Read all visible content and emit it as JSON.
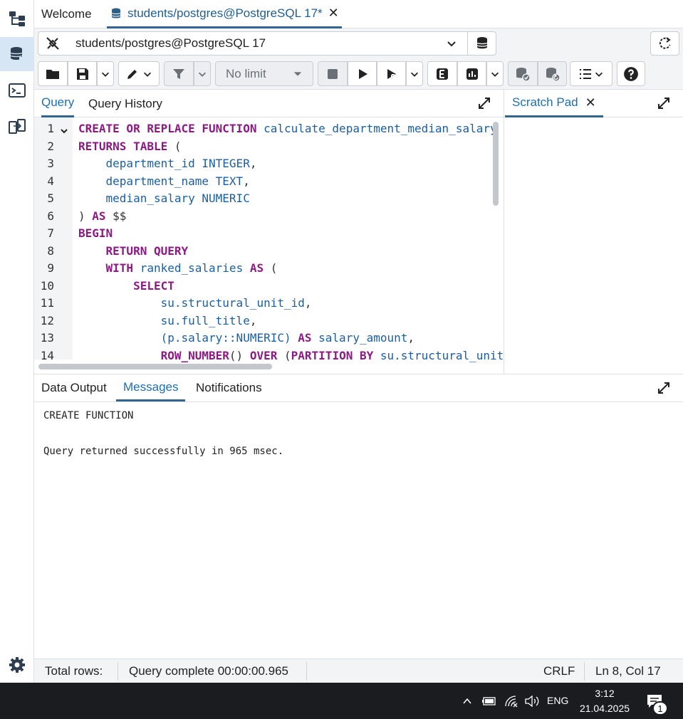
{
  "tabs": {
    "welcome": "Welcome",
    "query_tool": "students/postgres@PostgreSQL 17*"
  },
  "connection": {
    "selected": "students/postgres@PostgreSQL 17"
  },
  "toolbar": {
    "limit": "No limit"
  },
  "query_panel": {
    "tab_query": "Query",
    "tab_history": "Query History",
    "scratch_pad": "Scratch Pad"
  },
  "editor": {
    "line_numbers": [
      "1",
      "2",
      "3",
      "4",
      "5",
      "6",
      "7",
      "8",
      "9",
      "10",
      "11",
      "12",
      "13",
      "14"
    ],
    "lines": [
      [
        {
          "t": "CREATE OR REPLACE FUNCTION ",
          "c": "kw"
        },
        {
          "t": "calculate_department_median_salary",
          "c": "id"
        }
      ],
      [
        {
          "t": "RETURNS TABLE ",
          "c": "kw"
        },
        {
          "t": "(",
          "c": "op"
        }
      ],
      [
        {
          "t": "    department_id INTEGER",
          "c": "id"
        },
        {
          "t": ",",
          "c": "op"
        }
      ],
      [
        {
          "t": "    department_name TEXT",
          "c": "id"
        },
        {
          "t": ",",
          "c": "op"
        }
      ],
      [
        {
          "t": "    median_salary NUMERIC",
          "c": "id"
        }
      ],
      [
        {
          "t": ") ",
          "c": "op"
        },
        {
          "t": "AS ",
          "c": "kw"
        },
        {
          "t": "$$",
          "c": "op"
        }
      ],
      [
        {
          "t": "BEGIN",
          "c": "kw"
        }
      ],
      [
        {
          "t": "    RETURN QUERY",
          "c": "kw"
        }
      ],
      [
        {
          "t": "    WITH ",
          "c": "kw"
        },
        {
          "t": "ranked_salaries ",
          "c": "id"
        },
        {
          "t": "AS ",
          "c": "kw"
        },
        {
          "t": "(",
          "c": "op"
        }
      ],
      [
        {
          "t": "        SELECT",
          "c": "kw"
        }
      ],
      [
        {
          "t": "            su.structural_unit_id",
          "c": "id"
        },
        {
          "t": ",",
          "c": "op"
        }
      ],
      [
        {
          "t": "            su.full_title",
          "c": "id"
        },
        {
          "t": ",",
          "c": "op"
        }
      ],
      [
        {
          "t": "            (p.salary::NUMERIC) ",
          "c": "id"
        },
        {
          "t": "AS ",
          "c": "kw"
        },
        {
          "t": "salary_amount",
          "c": "id"
        },
        {
          "t": ",",
          "c": "op"
        }
      ],
      [
        {
          "t": "            ROW_NUMBER",
          "c": "kw"
        },
        {
          "t": "() ",
          "c": "op"
        },
        {
          "t": "OVER ",
          "c": "kw"
        },
        {
          "t": "(",
          "c": "op"
        },
        {
          "t": "PARTITION BY ",
          "c": "kw"
        },
        {
          "t": "su.structural_unit_id",
          "c": "id"
        }
      ]
    ]
  },
  "output": {
    "tab_data": "Data Output",
    "tab_messages": "Messages",
    "tab_notifications": "Notifications",
    "message_1": "CREATE FUNCTION",
    "message_2": "Query returned successfully in 965 msec."
  },
  "status": {
    "total_rows": "Total rows:",
    "query_complete": "Query complete 00:00:00.965",
    "line_ending": "CRLF",
    "cursor": "Ln 8, Col 17"
  },
  "taskbar": {
    "language": "ENG",
    "time": "3:12",
    "date": "21.04.2025",
    "notifications": "1"
  },
  "colors": {
    "accent": "#326690",
    "keyword": "#8b1b82",
    "identifier": "#1b5fa3"
  },
  "icons": [
    "object-explorer-icon",
    "query-tool-icon",
    "psql-icon",
    "schema-diff-icon",
    "settings-icon",
    "database-icon",
    "disconnect-icon",
    "refresh-icon",
    "open-folder-icon",
    "save-icon",
    "edit-icon",
    "filter-icon",
    "stop-icon",
    "execute-icon",
    "execute-cursor-icon",
    "explain-icon",
    "explain-analyze-icon",
    "commit-icon",
    "rollback-icon",
    "macros-icon",
    "help-icon",
    "expand-icon",
    "close-icon",
    "chevron-down-icon"
  ]
}
